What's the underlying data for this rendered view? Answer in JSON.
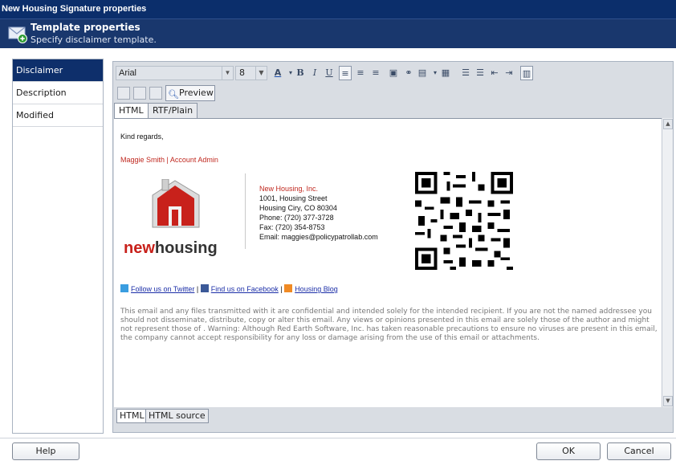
{
  "window": {
    "title": "New Housing Signature properties"
  },
  "header": {
    "title": "Template properties",
    "subtitle": "Specify disclaimer template."
  },
  "sidebar": {
    "items": [
      {
        "label": "Disclaimer"
      },
      {
        "label": "Description"
      },
      {
        "label": "Modified"
      }
    ]
  },
  "toolbar": {
    "font": "Arial",
    "size": "8",
    "preview_label": "Preview",
    "icons": [
      "font-color-icon",
      "bold-icon",
      "italic-icon",
      "underline-icon",
      "align-left-icon",
      "align-center-icon",
      "align-right-icon",
      "image-icon",
      "link-icon",
      "table-icon",
      "insert-field-icon",
      "ordered-list-icon",
      "unordered-list-icon",
      "outdent-icon",
      "indent-icon",
      "source-icon"
    ]
  },
  "tabs": {
    "top": [
      "HTML",
      "RTF/Plain"
    ],
    "bottom": [
      "HTML",
      "HTML source"
    ]
  },
  "signature": {
    "greeting": "Kind regards,",
    "name_line": "Maggie Smith | Account Admin",
    "company": "New Housing, Inc.",
    "address1": "1001, Housing Street",
    "address2": "Housing Ciry, CO 80304",
    "phone": "Phone: (720) 377-3728",
    "fax": "Fax: (720) 354-8753",
    "email": "Email: maggies@policypatrollab.com",
    "logo_text_bold": "new",
    "logo_text_rest": "housing",
    "social": {
      "twitter": "Follow us on Twitter",
      "facebook": "Find us on Facebook",
      "blog": "Housing Blog",
      "separator": "|"
    },
    "disclaimer": "This email and any files transmitted with it are confidential and intended solely for the intended recipient. If you are not the named addressee you should not disseminate, distribute, copy or alter this email. Any views or opinions presented in this email are solely those of the author and might not represent those of . Warning: Although Red Earth Software, Inc. has taken reasonable precautions to ensure no viruses are present in this email, the company cannot accept responsibility for any loss or damage arising from the use of this email or attachments."
  },
  "buttons": {
    "help": "Help",
    "ok": "OK",
    "cancel": "Cancel"
  },
  "colors": {
    "title_bg": "#0b2e6b",
    "header_bg": "#19376d",
    "accent_red": "#c0281f",
    "link": "#1c2fa8"
  }
}
